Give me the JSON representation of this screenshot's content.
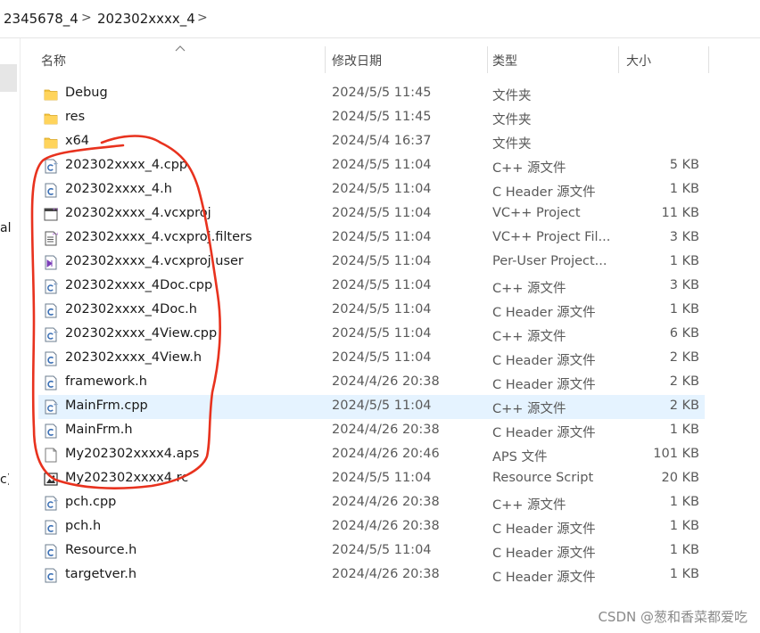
{
  "breadcrumb": {
    "items": [
      "2345678_4",
      "202302xxxx_4"
    ],
    "separator": ">"
  },
  "left_pane": {
    "partial_texts": [
      "al",
      "c)"
    ]
  },
  "columns": {
    "name": "名称",
    "modified": "修改日期",
    "type": "类型",
    "size": "大小"
  },
  "files": [
    {
      "name": "Debug",
      "modified": "2024/5/5 11:45",
      "type": "文件夹",
      "size": "",
      "icon": "folder-icon"
    },
    {
      "name": "res",
      "modified": "2024/5/5 11:45",
      "type": "文件夹",
      "size": "",
      "icon": "folder-icon"
    },
    {
      "name": "x64",
      "modified": "2024/5/4 16:37",
      "type": "文件夹",
      "size": "",
      "icon": "folder-icon"
    },
    {
      "name": "202302xxxx_4.cpp",
      "modified": "2024/5/5 11:04",
      "type": "C++ 源文件",
      "size": "5 KB",
      "icon": "cpp-file-icon"
    },
    {
      "name": "202302xxxx_4.h",
      "modified": "2024/5/5 11:04",
      "type": "C Header 源文件",
      "size": "1 KB",
      "icon": "header-file-icon"
    },
    {
      "name": "202302xxxx_4.vcxproj",
      "modified": "2024/5/5 11:04",
      "type": "VC++ Project",
      "size": "11 KB",
      "icon": "vcxproj-file-icon"
    },
    {
      "name": "202302xxxx_4.vcxproj.filters",
      "modified": "2024/5/5 11:04",
      "type": "VC++ Project Fil...",
      "size": "3 KB",
      "icon": "filters-file-icon"
    },
    {
      "name": "202302xxxx_4.vcxproj.user",
      "modified": "2024/5/5 11:04",
      "type": "Per-User Project...",
      "size": "1 KB",
      "icon": "user-file-icon"
    },
    {
      "name": "202302xxxx_4Doc.cpp",
      "modified": "2024/5/5 11:04",
      "type": "C++ 源文件",
      "size": "3 KB",
      "icon": "cpp-file-icon"
    },
    {
      "name": "202302xxxx_4Doc.h",
      "modified": "2024/5/5 11:04",
      "type": "C Header 源文件",
      "size": "1 KB",
      "icon": "header-file-icon"
    },
    {
      "name": "202302xxxx_4View.cpp",
      "modified": "2024/5/5 11:04",
      "type": "C++ 源文件",
      "size": "6 KB",
      "icon": "cpp-file-icon"
    },
    {
      "name": "202302xxxx_4View.h",
      "modified": "2024/5/5 11:04",
      "type": "C Header 源文件",
      "size": "2 KB",
      "icon": "header-file-icon"
    },
    {
      "name": "framework.h",
      "modified": "2024/4/26 20:38",
      "type": "C Header 源文件",
      "size": "2 KB",
      "icon": "header-file-icon"
    },
    {
      "name": "MainFrm.cpp",
      "modified": "2024/5/5 11:04",
      "type": "C++ 源文件",
      "size": "2 KB",
      "icon": "cpp-file-icon",
      "hover": true
    },
    {
      "name": "MainFrm.h",
      "modified": "2024/4/26 20:38",
      "type": "C Header 源文件",
      "size": "1 KB",
      "icon": "header-file-icon"
    },
    {
      "name": "My202302xxxx4.aps",
      "modified": "2024/4/26 20:46",
      "type": "APS 文件",
      "size": "101 KB",
      "icon": "generic-file-icon"
    },
    {
      "name": "My202302xxxx4.rc",
      "modified": "2024/5/5 11:04",
      "type": "Resource Script",
      "size": "20 KB",
      "icon": "rc-file-icon"
    },
    {
      "name": "pch.cpp",
      "modified": "2024/4/26 20:38",
      "type": "C++ 源文件",
      "size": "1 KB",
      "icon": "cpp-file-icon"
    },
    {
      "name": "pch.h",
      "modified": "2024/4/26 20:38",
      "type": "C Header 源文件",
      "size": "1 KB",
      "icon": "header-file-icon"
    },
    {
      "name": "Resource.h",
      "modified": "2024/5/5 11:04",
      "type": "C Header 源文件",
      "size": "1 KB",
      "icon": "header-file-icon"
    },
    {
      "name": "targetver.h",
      "modified": "2024/4/26 20:38",
      "type": "C Header 源文件",
      "size": "1 KB",
      "icon": "header-file-icon"
    }
  ],
  "watermark": "CSDN @葱和香菜都爱吃",
  "colors": {
    "folder": "#f2c94c",
    "hover_row": "#e5f3ff",
    "annotation": "#e8321e"
  }
}
